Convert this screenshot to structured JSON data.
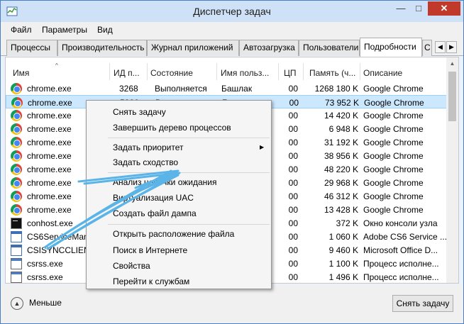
{
  "window": {
    "title": "Диспетчер задач"
  },
  "titlebar": {
    "minimize_icon": "minimize-icon",
    "maximize_icon": "maximize-icon",
    "close_icon": "close-icon",
    "minimize_glyph": "—",
    "maximize_glyph": "□",
    "close_glyph": "✕"
  },
  "menu": {
    "items": [
      "Файл",
      "Параметры",
      "Вид"
    ]
  },
  "tabs": [
    "Процессы",
    "Производительность",
    "Журнал приложений",
    "Автозагрузка",
    "Пользователи",
    "Подробности",
    "С"
  ],
  "active_tab": "Подробности",
  "tab_scroll": {
    "left_glyph": "◀",
    "right_glyph": "▶"
  },
  "columns": [
    "Имя",
    "ИД п...",
    "Состояние",
    "Имя польз...",
    "ЦП",
    "Память (ч...",
    "Описание"
  ],
  "sort_glyph": "^",
  "rows": [
    {
      "icon": "chrome-icon",
      "name": "chrome.exe",
      "pid": "3268",
      "status": "Выполняется",
      "user": "Башлак",
      "cpu": "00",
      "mem": "1268 180 K",
      "desc": "Google Chrome"
    },
    {
      "icon": "chrome-icon",
      "name": "chrome.exe",
      "pid": "5826",
      "status": "Выполняется",
      "user": "Башлак",
      "cpu": "00",
      "mem": "73 952 K",
      "desc": "Google Chrome",
      "selected": true
    },
    {
      "icon": "chrome-icon",
      "name": "chrome.exe",
      "pid": "",
      "status": "",
      "user": "",
      "cpu": "00",
      "mem": "14 420 K",
      "desc": "Google Chrome"
    },
    {
      "icon": "chrome-icon",
      "name": "chrome.exe",
      "pid": "",
      "status": "",
      "user": "",
      "cpu": "00",
      "mem": "6 948 K",
      "desc": "Google Chrome"
    },
    {
      "icon": "chrome-icon",
      "name": "chrome.exe",
      "pid": "",
      "status": "",
      "user": "",
      "cpu": "00",
      "mem": "31 192 K",
      "desc": "Google Chrome"
    },
    {
      "icon": "chrome-icon",
      "name": "chrome.exe",
      "pid": "",
      "status": "",
      "user": "",
      "cpu": "00",
      "mem": "38 956 K",
      "desc": "Google Chrome"
    },
    {
      "icon": "chrome-icon",
      "name": "chrome.exe",
      "pid": "",
      "status": "",
      "user": "",
      "cpu": "00",
      "mem": "48 220 K",
      "desc": "Google Chrome"
    },
    {
      "icon": "chrome-icon",
      "name": "chrome.exe",
      "pid": "",
      "status": "",
      "user": "",
      "cpu": "00",
      "mem": "29 968 K",
      "desc": "Google Chrome"
    },
    {
      "icon": "chrome-icon",
      "name": "chrome.exe",
      "pid": "",
      "status": "",
      "user": "",
      "cpu": "00",
      "mem": "46 312 K",
      "desc": "Google Chrome"
    },
    {
      "icon": "chrome-icon",
      "name": "chrome.exe",
      "pid": "",
      "status": "",
      "user": "",
      "cpu": "00",
      "mem": "13 428 K",
      "desc": "Google Chrome"
    },
    {
      "icon": "cmd-icon",
      "name": "conhost.exe",
      "pid": "",
      "status": "",
      "user": "",
      "cpu": "00",
      "mem": "372 K",
      "desc": "Окно консоли узла"
    },
    {
      "icon": "app-box-icon",
      "name": "CS6ServiceManag",
      "pid": "",
      "status": "",
      "user": "",
      "cpu": "00",
      "mem": "1 060 K",
      "desc": "Adobe CS6 Service ..."
    },
    {
      "icon": "app-box-icon",
      "name": "CSISYNCCLIENT.E",
      "pid": "",
      "status": "",
      "user": "",
      "cpu": "00",
      "mem": "9 460 K",
      "desc": "Microsoft Office D..."
    },
    {
      "icon": "csrss-icon",
      "name": "csrss.exe",
      "pid": "",
      "status": "",
      "user": "",
      "cpu": "00",
      "mem": "1 100 K",
      "desc": "Процесс исполне..."
    },
    {
      "icon": "csrss-icon",
      "name": "csrss.exe",
      "pid": "",
      "status": "",
      "user": "",
      "cpu": "00",
      "mem": "1 496 K",
      "desc": "Процесс исполне..."
    }
  ],
  "scrollbar": {
    "up_glyph": "▲"
  },
  "context_menu": {
    "items": [
      {
        "label": "Снять задачу"
      },
      {
        "label": "Завершить дерево процессов"
      },
      {
        "label": "Задать приоритет",
        "submenu": true
      },
      {
        "label": "Задать сходство"
      },
      {
        "label": "Анализ цепочки ожидания"
      },
      {
        "label": "Виртуализация UAC"
      },
      {
        "label": "Создать файл дампа"
      },
      {
        "label": "Открыть расположение файла"
      },
      {
        "label": "Поиск в Интернете"
      },
      {
        "label": "Свойства"
      },
      {
        "label": "Перейти к службам"
      }
    ],
    "submenu_glyph": "▶"
  },
  "bottom": {
    "less_label": "Меньше",
    "less_glyph": "▲",
    "end_task_label": "Снять задачу"
  },
  "colors": {
    "selection": "#cce8ff",
    "close_button": "#c0392b",
    "annotation_arrow": "#5ab4e8"
  }
}
